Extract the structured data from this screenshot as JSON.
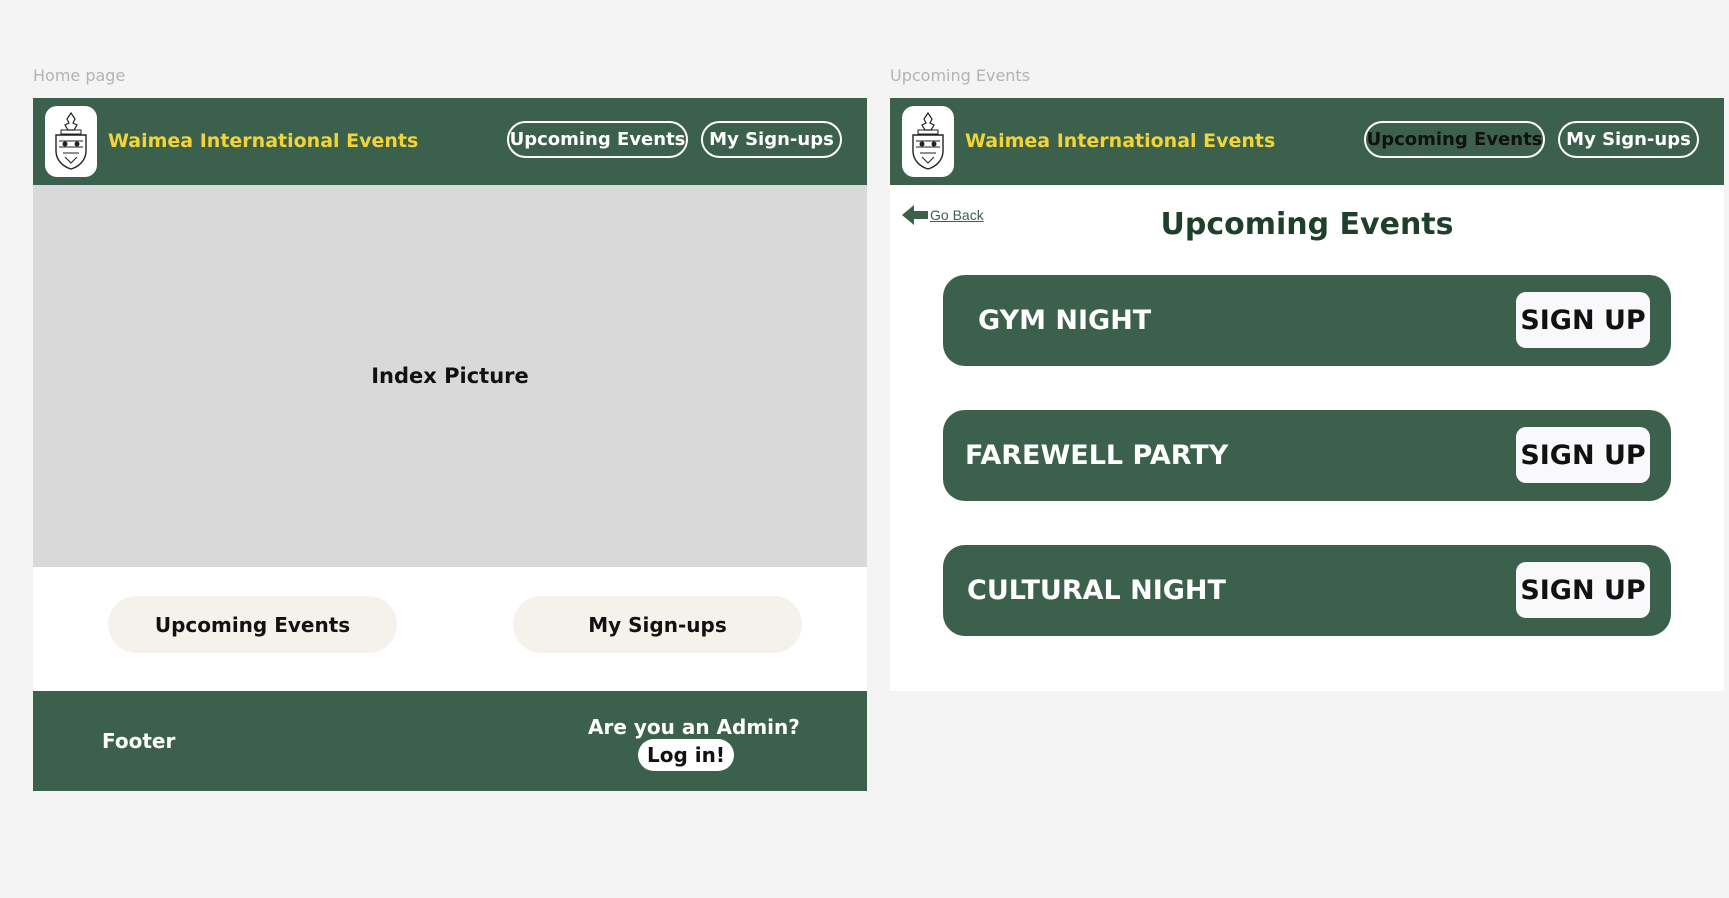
{
  "frames": {
    "home_label": "Home page",
    "events_label": "Upcoming Events"
  },
  "header": {
    "site_title": "Waimea International Events",
    "nav_upcoming": "Upcoming Events",
    "nav_signups": "My Sign-ups",
    "logo_icon": "school-crest-icon"
  },
  "home": {
    "hero_text": "Index Picture",
    "button_upcoming": "Upcoming Events",
    "button_signups": "My Sign-ups",
    "footer_text": "Footer",
    "admin_question": "Are you an Admin?",
    "login_label": "Log in!"
  },
  "events_page": {
    "go_back": "Go Back",
    "heading": "Upcoming Events",
    "events": [
      {
        "name": "GYM NIGHT",
        "action": "SIGN UP"
      },
      {
        "name": "FAREWELL PARTY",
        "action": "SIGN UP"
      },
      {
        "name": "CULTURAL NIGHT",
        "action": "SIGN UP"
      }
    ]
  },
  "colors": {
    "brand_green": "#3b604c",
    "title_yellow": "#f2d43a",
    "heading_green": "#1d3f2b",
    "pill_bg": "#f5f2ec",
    "hero_bg": "#d9d9d9"
  }
}
